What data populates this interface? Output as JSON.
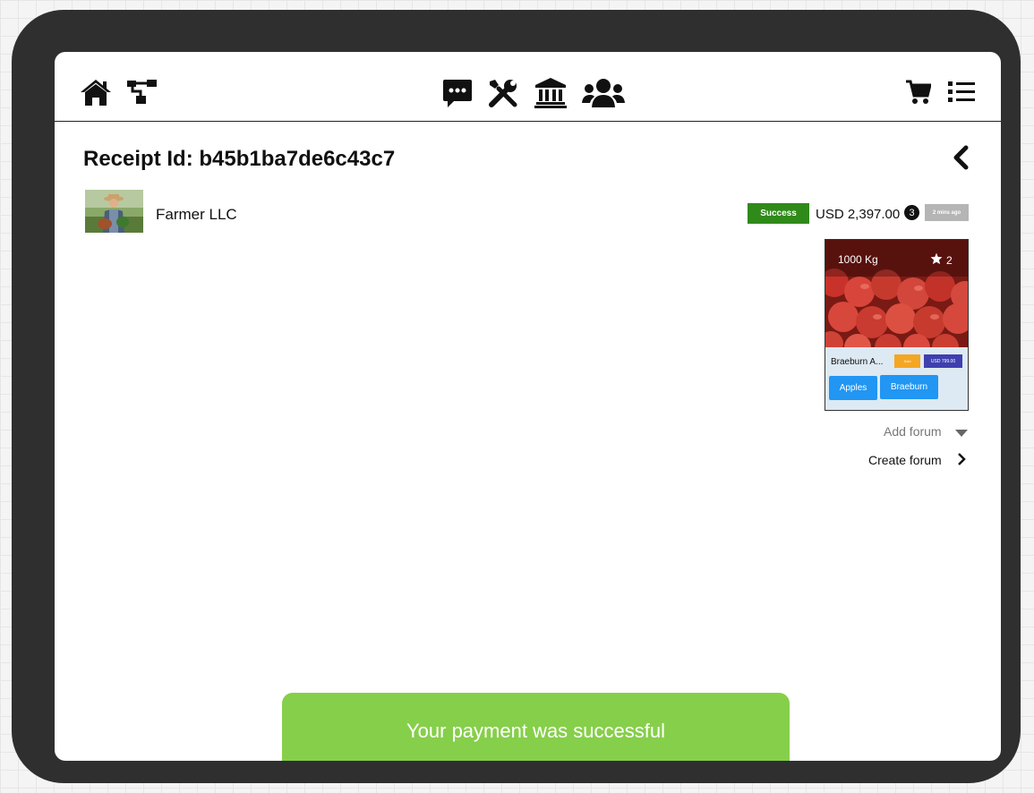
{
  "nav": {
    "left_icons": [
      "home-icon",
      "sitemap-icon"
    ],
    "center_icons": [
      "chat-icon",
      "tools-icon",
      "bank-icon",
      "users-icon"
    ],
    "right_icons": [
      "cart-icon",
      "list-icon"
    ]
  },
  "receipt": {
    "title": "Receipt Id: b45b1ba7de6c43c7"
  },
  "seller": {
    "name": "Farmer LLC"
  },
  "order": {
    "status": "Success",
    "status_color": "#2f8a1a",
    "amount": "USD 2,397.00",
    "count": "3",
    "time": "2 mins ago"
  },
  "product": {
    "weight": "1000 Kg",
    "rating": "2",
    "name": "Braeburn A...",
    "tag": "Sold",
    "price": "USD 799.00",
    "chips": [
      "Apples",
      "Braeburn"
    ]
  },
  "forum": {
    "add_label": "Add forum",
    "create_label": "Create forum"
  },
  "toast": {
    "message": "Your payment was successful",
    "color": "#86cf4a"
  }
}
